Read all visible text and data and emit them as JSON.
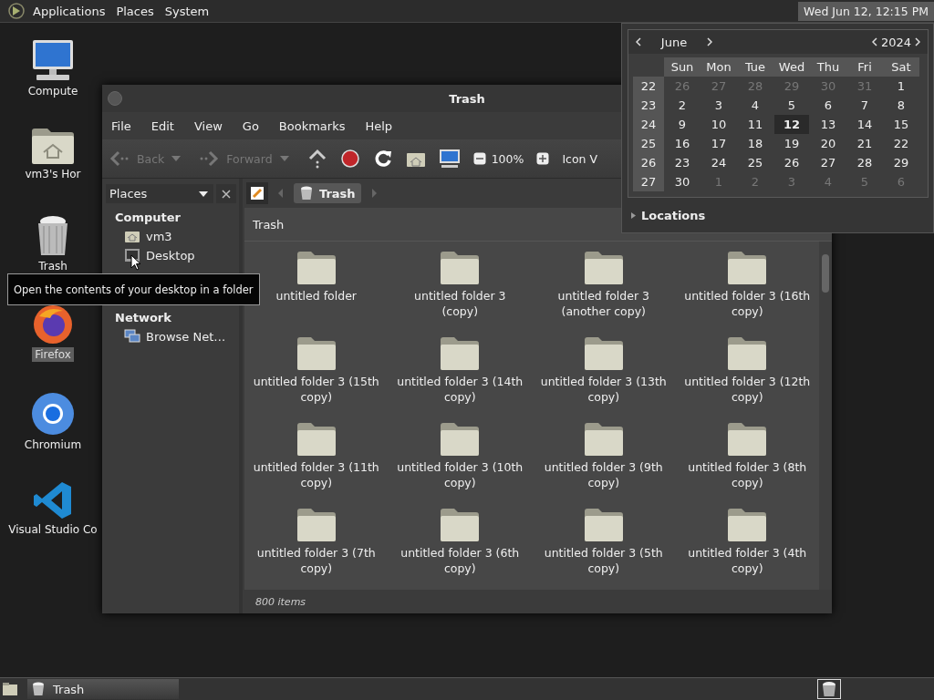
{
  "top_panel": {
    "menus": [
      "Applications",
      "Places",
      "System"
    ],
    "clock": "Wed Jun 12, 12:15 PM"
  },
  "desktop_icons": [
    {
      "kind": "computer",
      "label": "Compute",
      "selected": false
    },
    {
      "kind": "home",
      "label": "vm3's Hor",
      "selected": false
    },
    {
      "kind": "trash",
      "label": "Trash",
      "selected": false
    },
    {
      "kind": "firefox",
      "label": "Firefox",
      "selected": true
    },
    {
      "kind": "chromium",
      "label": "Chromium",
      "selected": false
    },
    {
      "kind": "vscode",
      "label": "Visual Studio Co",
      "selected": false
    }
  ],
  "window": {
    "title": "Trash",
    "menu": [
      "File",
      "Edit",
      "View",
      "Go",
      "Bookmarks",
      "Help"
    ],
    "toolbar": [
      {
        "kind": "back",
        "label": "Back",
        "disabled": true
      },
      {
        "kind": "forward",
        "label": "Forward",
        "disabled": true
      },
      {
        "kind": "up",
        "disabled": false
      },
      {
        "kind": "stop",
        "disabled": false
      },
      {
        "kind": "reload",
        "disabled": false
      },
      {
        "kind": "home",
        "disabled": false
      },
      {
        "kind": "computer",
        "disabled": false
      },
      {
        "kind": "zoom-out",
        "disabled": false
      },
      {
        "kind": "zoom-level",
        "label": "100%",
        "disabled": false
      },
      {
        "kind": "zoom-in",
        "disabled": false
      },
      {
        "kind": "view",
        "label": "Icon V",
        "disabled": false
      }
    ]
  },
  "sidebar": {
    "selector": "Places",
    "sections": [
      {
        "heading": "Computer",
        "items": [
          {
            "kind": "home",
            "label": "vm3"
          },
          {
            "kind": "desktop",
            "label": "Desktop"
          }
        ]
      },
      {
        "heading": "Network",
        "items": [
          {
            "kind": "network",
            "label": "Browse Net…"
          }
        ]
      }
    ]
  },
  "pathbar": {
    "buttons": [
      {
        "label": "Trash",
        "selected": true
      }
    ]
  },
  "content": {
    "title": "Trash",
    "items": [
      "untitled folder",
      "untitled folder 3 (copy)",
      "untitled folder 3 (another copy)",
      "untitled folder 3 (16th copy)",
      "untitled folder 3 (15th copy)",
      "untitled folder 3 (14th copy)",
      "untitled folder 3 (13th copy)",
      "untitled folder 3 (12th copy)",
      "untitled folder 3 (11th copy)",
      "untitled folder 3 (10th copy)",
      "untitled folder 3 (9th copy)",
      "untitled folder 3 (8th copy)",
      "untitled folder 3 (7th copy)",
      "untitled folder 3 (6th copy)",
      "untitled folder 3 (5th copy)",
      "untitled folder 3 (4th copy)"
    ],
    "status": "800 items"
  },
  "tooltip": "Open the contents of your desktop in a folder",
  "calendar": {
    "month": "June",
    "year": "2024",
    "weekdays": [
      "Sun",
      "Mon",
      "Tue",
      "Wed",
      "Thu",
      "Fri",
      "Sat"
    ],
    "weeks": [
      {
        "number": "22",
        "days": [
          {
            "day": "26",
            "other_month": true,
            "selected": false
          },
          {
            "day": "27",
            "other_month": true,
            "selected": false
          },
          {
            "day": "28",
            "other_month": true,
            "selected": false
          },
          {
            "day": "29",
            "other_month": true,
            "selected": false
          },
          {
            "day": "30",
            "other_month": true,
            "selected": false
          },
          {
            "day": "31",
            "other_month": true,
            "selected": false
          },
          {
            "day": "1",
            "other_month": false,
            "selected": false
          }
        ]
      },
      {
        "number": "23",
        "days": [
          {
            "day": "2",
            "other_month": false,
            "selected": false
          },
          {
            "day": "3",
            "other_month": false,
            "selected": false
          },
          {
            "day": "4",
            "other_month": false,
            "selected": false
          },
          {
            "day": "5",
            "other_month": false,
            "selected": false
          },
          {
            "day": "6",
            "other_month": false,
            "selected": false
          },
          {
            "day": "7",
            "other_month": false,
            "selected": false
          },
          {
            "day": "8",
            "other_month": false,
            "selected": false
          }
        ]
      },
      {
        "number": "24",
        "days": [
          {
            "day": "9",
            "other_month": false,
            "selected": false
          },
          {
            "day": "10",
            "other_month": false,
            "selected": false
          },
          {
            "day": "11",
            "other_month": false,
            "selected": false
          },
          {
            "day": "12",
            "other_month": false,
            "selected": true
          },
          {
            "day": "13",
            "other_month": false,
            "selected": false
          },
          {
            "day": "14",
            "other_month": false,
            "selected": false
          },
          {
            "day": "15",
            "other_month": false,
            "selected": false
          }
        ]
      },
      {
        "number": "25",
        "days": [
          {
            "day": "16",
            "other_month": false,
            "selected": false
          },
          {
            "day": "17",
            "other_month": false,
            "selected": false
          },
          {
            "day": "18",
            "other_month": false,
            "selected": false
          },
          {
            "day": "19",
            "other_month": false,
            "selected": false
          },
          {
            "day": "20",
            "other_month": false,
            "selected": false
          },
          {
            "day": "21",
            "other_month": false,
            "selected": false
          },
          {
            "day": "22",
            "other_month": false,
            "selected": false
          }
        ]
      },
      {
        "number": "26",
        "days": [
          {
            "day": "23",
            "other_month": false,
            "selected": false
          },
          {
            "day": "24",
            "other_month": false,
            "selected": false
          },
          {
            "day": "25",
            "other_month": false,
            "selected": false
          },
          {
            "day": "26",
            "other_month": false,
            "selected": false
          },
          {
            "day": "27",
            "other_month": false,
            "selected": false
          },
          {
            "day": "28",
            "other_month": false,
            "selected": false
          },
          {
            "day": "29",
            "other_month": false,
            "selected": false
          }
        ]
      },
      {
        "number": "27",
        "days": [
          {
            "day": "30",
            "other_month": false,
            "selected": false
          },
          {
            "day": "1",
            "other_month": true,
            "selected": false
          },
          {
            "day": "2",
            "other_month": true,
            "selected": false
          },
          {
            "day": "3",
            "other_month": true,
            "selected": false
          },
          {
            "day": "4",
            "other_month": true,
            "selected": false
          },
          {
            "day": "5",
            "other_month": true,
            "selected": false
          },
          {
            "day": "6",
            "other_month": true,
            "selected": false
          }
        ]
      }
    ],
    "locations": "Locations"
  },
  "taskbar": {
    "tasks": [
      {
        "label": "Trash",
        "selected": true
      }
    ]
  }
}
